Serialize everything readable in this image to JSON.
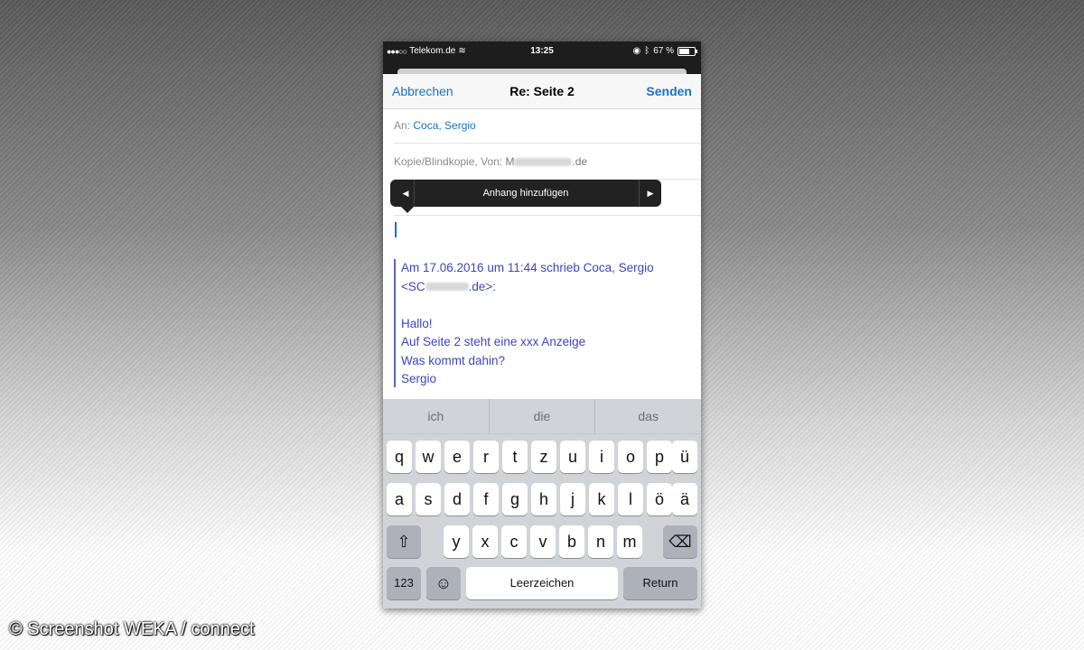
{
  "status_bar": {
    "signal": "●●●○○",
    "carrier": "Telekom.de",
    "wifi_icon": "≋",
    "time": "13:25",
    "location_icon": "◉",
    "bluetooth_icon": "ᛒ",
    "battery_text": "67 %",
    "battery_level": 0.67
  },
  "nav": {
    "cancel": "Abbrechen",
    "title": "Re: Seite 2",
    "send": "Senden"
  },
  "to_row": {
    "label": "An:",
    "value": "Coca, Sergio"
  },
  "cc_row": {
    "label": "Kopie/Blindkopie, Von:",
    "addr_prefix": "M",
    "addr_suffix": ".de"
  },
  "popover": {
    "left_arrow": "◀",
    "label": "Anhang hinzufügen",
    "right_arrow": "▶"
  },
  "quote": {
    "line1": "Am 17.06.2016 um 11:44 schrieb Coca, Sergio",
    "line2_prefix": "<SC",
    "line2_suffix": ".de>:",
    "line3": "Hallo!",
    "line4": "Auf Seite 2 steht eine xxx Anzeige",
    "line5": "Was kommt dahin?",
    "line6": "Sergio"
  },
  "suggestions": [
    "ich",
    "die",
    "das"
  ],
  "keyboard": {
    "row1": [
      "q",
      "w",
      "e",
      "r",
      "t",
      "z",
      "u",
      "i",
      "o",
      "p",
      "ü"
    ],
    "row2": [
      "a",
      "s",
      "d",
      "f",
      "g",
      "h",
      "j",
      "k",
      "l",
      "ö",
      "ä"
    ],
    "row3": [
      "y",
      "x",
      "c",
      "v",
      "b",
      "n",
      "m"
    ],
    "shift_icon": "⇧",
    "delete_icon": "⌫",
    "numbers": "123",
    "emoji_icon": "☺",
    "space": "Leerzeichen",
    "return": "Return"
  },
  "watermark": "© Screenshot WEKA / connect"
}
